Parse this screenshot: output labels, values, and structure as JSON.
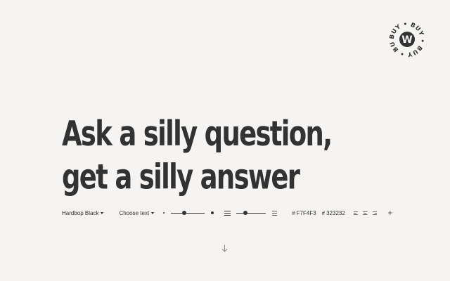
{
  "badge": {
    "word": "BUY",
    "letter": "W"
  },
  "headline": {
    "text": "Ask a silly question, get a silly answer"
  },
  "toolbar": {
    "font_label": "Hardbop Black",
    "text_label": "Choose text",
    "size_slider_value": 0.4,
    "leading_slider_value": 0.3,
    "background_hex": "F7F4F3",
    "text_hex": "323232",
    "hash": "#"
  },
  "colors": {
    "background": "#F7F4F3",
    "text": "#323232"
  },
  "icons": {
    "alignment": [
      "align-left-icon",
      "align-center-icon",
      "align-right-icon"
    ],
    "add": "plus-icon",
    "scroll": "arrow-down-icon"
  }
}
